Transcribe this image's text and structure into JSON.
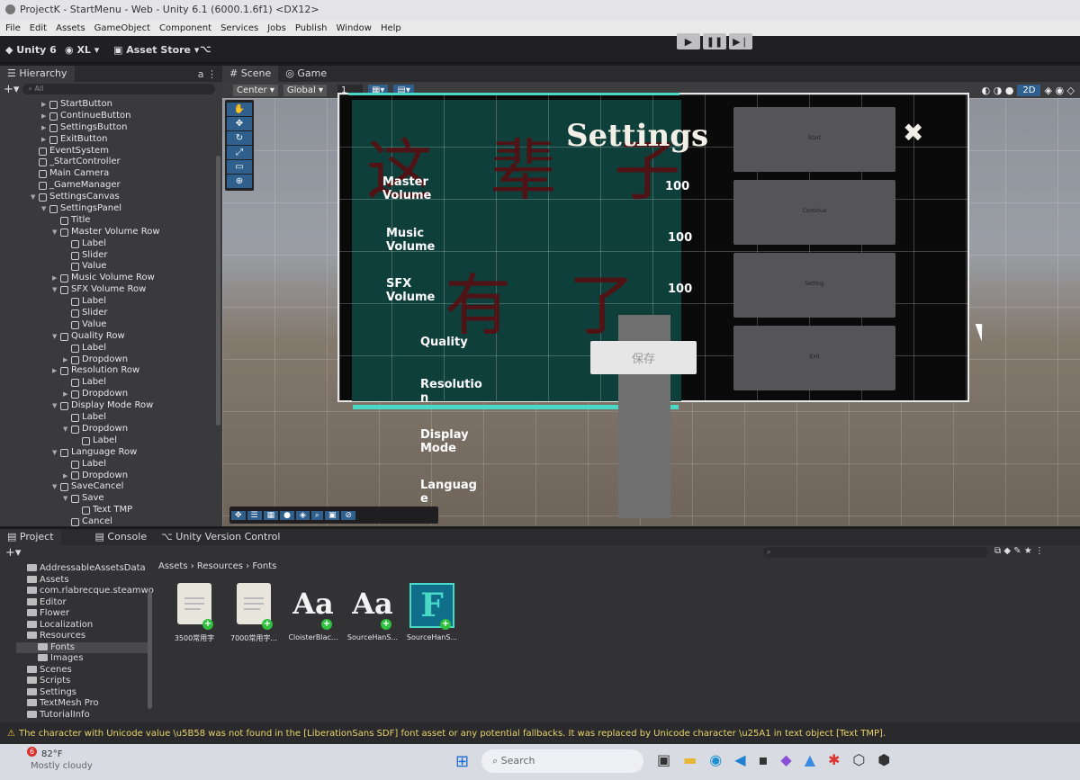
{
  "window": {
    "title": "ProjectK - StartMenu - Web - Unity 6.1 (6000.1.6f1) <DX12>"
  },
  "menu": [
    "File",
    "Edit",
    "Assets",
    "GameObject",
    "Component",
    "Services",
    "Jobs",
    "Publish",
    "Window",
    "Help"
  ],
  "toolbar": {
    "unity_label": "Unity 6",
    "account_label": "XL",
    "asset_store_label": "Asset Store"
  },
  "hierarchy": {
    "tab": "Hierarchy",
    "search_placeholder": "All",
    "items": [
      {
        "label": "StartButton",
        "level": 2,
        "arrow": "▶"
      },
      {
        "label": "ContinueButton",
        "level": 2,
        "arrow": "▶"
      },
      {
        "label": "SettingsButton",
        "level": 2,
        "arrow": "▶"
      },
      {
        "label": "ExitButton",
        "level": 2,
        "arrow": "▶"
      },
      {
        "label": "EventSystem",
        "level": 1,
        "arrow": ""
      },
      {
        "label": "_StartController",
        "level": 1,
        "arrow": ""
      },
      {
        "label": "Main Camera",
        "level": 1,
        "arrow": ""
      },
      {
        "label": "_GameManager",
        "level": 1,
        "arrow": ""
      },
      {
        "label": "SettingsCanvas",
        "level": 1,
        "arrow": "▼"
      },
      {
        "label": "SettingsPanel",
        "level": 2,
        "arrow": "▼"
      },
      {
        "label": "Title",
        "level": 3,
        "arrow": ""
      },
      {
        "label": "Master Volume Row",
        "level": 3,
        "arrow": "▼"
      },
      {
        "label": "Label",
        "level": 4,
        "arrow": ""
      },
      {
        "label": "Slider",
        "level": 4,
        "arrow": ""
      },
      {
        "label": "Value",
        "level": 4,
        "arrow": ""
      },
      {
        "label": "Music Volume Row",
        "level": 3,
        "arrow": "▶"
      },
      {
        "label": "SFX Volume Row",
        "level": 3,
        "arrow": "▼"
      },
      {
        "label": "Label",
        "level": 4,
        "arrow": ""
      },
      {
        "label": "Slider",
        "level": 4,
        "arrow": ""
      },
      {
        "label": "Value",
        "level": 4,
        "arrow": ""
      },
      {
        "label": "Quality Row",
        "level": 3,
        "arrow": "▼"
      },
      {
        "label": "Label",
        "level": 4,
        "arrow": ""
      },
      {
        "label": "Dropdown",
        "level": 4,
        "arrow": "▶"
      },
      {
        "label": "Resolution Row",
        "level": 3,
        "arrow": "▶"
      },
      {
        "label": "Label",
        "level": 4,
        "arrow": ""
      },
      {
        "label": "Dropdown",
        "level": 4,
        "arrow": "▶"
      },
      {
        "label": "Display Mode Row",
        "level": 3,
        "arrow": "▼"
      },
      {
        "label": "Label",
        "level": 4,
        "arrow": ""
      },
      {
        "label": "Dropdown",
        "level": 4,
        "arrow": "▼"
      },
      {
        "label": "Label",
        "level": 5,
        "arrow": ""
      },
      {
        "label": "Language Row",
        "level": 3,
        "arrow": "▼"
      },
      {
        "label": "Label",
        "level": 4,
        "arrow": ""
      },
      {
        "label": "Dropdown",
        "level": 4,
        "arrow": "▶"
      },
      {
        "label": "SaveCancel",
        "level": 3,
        "arrow": "▼"
      },
      {
        "label": "Save",
        "level": 4,
        "arrow": "▼"
      },
      {
        "label": "Text TMP",
        "level": 5,
        "arrow": ""
      },
      {
        "label": "Cancel",
        "level": 4,
        "arrow": ""
      }
    ]
  },
  "scene": {
    "tab_scene": "Scene",
    "tab_game": "Game",
    "pivot": "Center",
    "space": "Global",
    "grid_value": "1",
    "mode_2d": "2D",
    "settings_title": "Settings",
    "close_glyph": "✖",
    "rows": [
      {
        "label": "Master\nVolume",
        "value": "100"
      },
      {
        "label": "Music\nVolume",
        "value": "100"
      },
      {
        "label": "SFX\nVolume",
        "value": "100"
      }
    ],
    "quality_label": "Quality",
    "resolution_label": "Resolutio\nn",
    "display_mode_label": "Display\nMode",
    "language_label": "Languag\ne",
    "save_button": "保存",
    "side_buttons": [
      "Start",
      "Continue",
      "Setting",
      "Exit"
    ]
  },
  "project": {
    "tabs": [
      "Project",
      "Console",
      "Unity Version Control"
    ],
    "breadcrumb": [
      "Assets",
      "Resources",
      "Fonts"
    ],
    "tree": [
      {
        "label": "AddressableAssetsData",
        "level": 1
      },
      {
        "label": "Assets",
        "level": 1
      },
      {
        "label": "com.rlabrecque.steamwo",
        "level": 1
      },
      {
        "label": "Editor",
        "level": 1
      },
      {
        "label": "Flower",
        "level": 1
      },
      {
        "label": "Localization",
        "level": 1
      },
      {
        "label": "Resources",
        "level": 1
      },
      {
        "label": "Fonts",
        "level": 2
      },
      {
        "label": "Images",
        "level": 2
      },
      {
        "label": "Scenes",
        "level": 1
      },
      {
        "label": "Scripts",
        "level": 1
      },
      {
        "label": "Settings",
        "level": 1
      },
      {
        "label": "TextMesh Pro",
        "level": 1
      },
      {
        "label": "TutorialInfo",
        "level": 1
      }
    ],
    "assets": [
      {
        "name": "3500常用字",
        "kind": "doc"
      },
      {
        "name": "7000常用字...",
        "kind": "doc"
      },
      {
        "name": "CloisterBlac...",
        "kind": "font"
      },
      {
        "name": "SourceHanS...",
        "kind": "font"
      },
      {
        "name": "SourceHanS...",
        "kind": "fontasset"
      }
    ]
  },
  "status": {
    "message": "The character with Unicode value \\u5B58 was not found in the [LiberationSans SDF] font asset or any potential fallbacks. It was replaced by Unicode character \\u25A1 in text object [Text  TMP]."
  },
  "taskbar": {
    "temp": "82°F",
    "weather": "Mostly cloudy",
    "badge": "6",
    "search_placeholder": "Search"
  },
  "colors": {
    "panel_teal": "#0e3f3a",
    "accent_cyan": "#4ad9c6",
    "unity_blue": "#2f5f8c"
  }
}
